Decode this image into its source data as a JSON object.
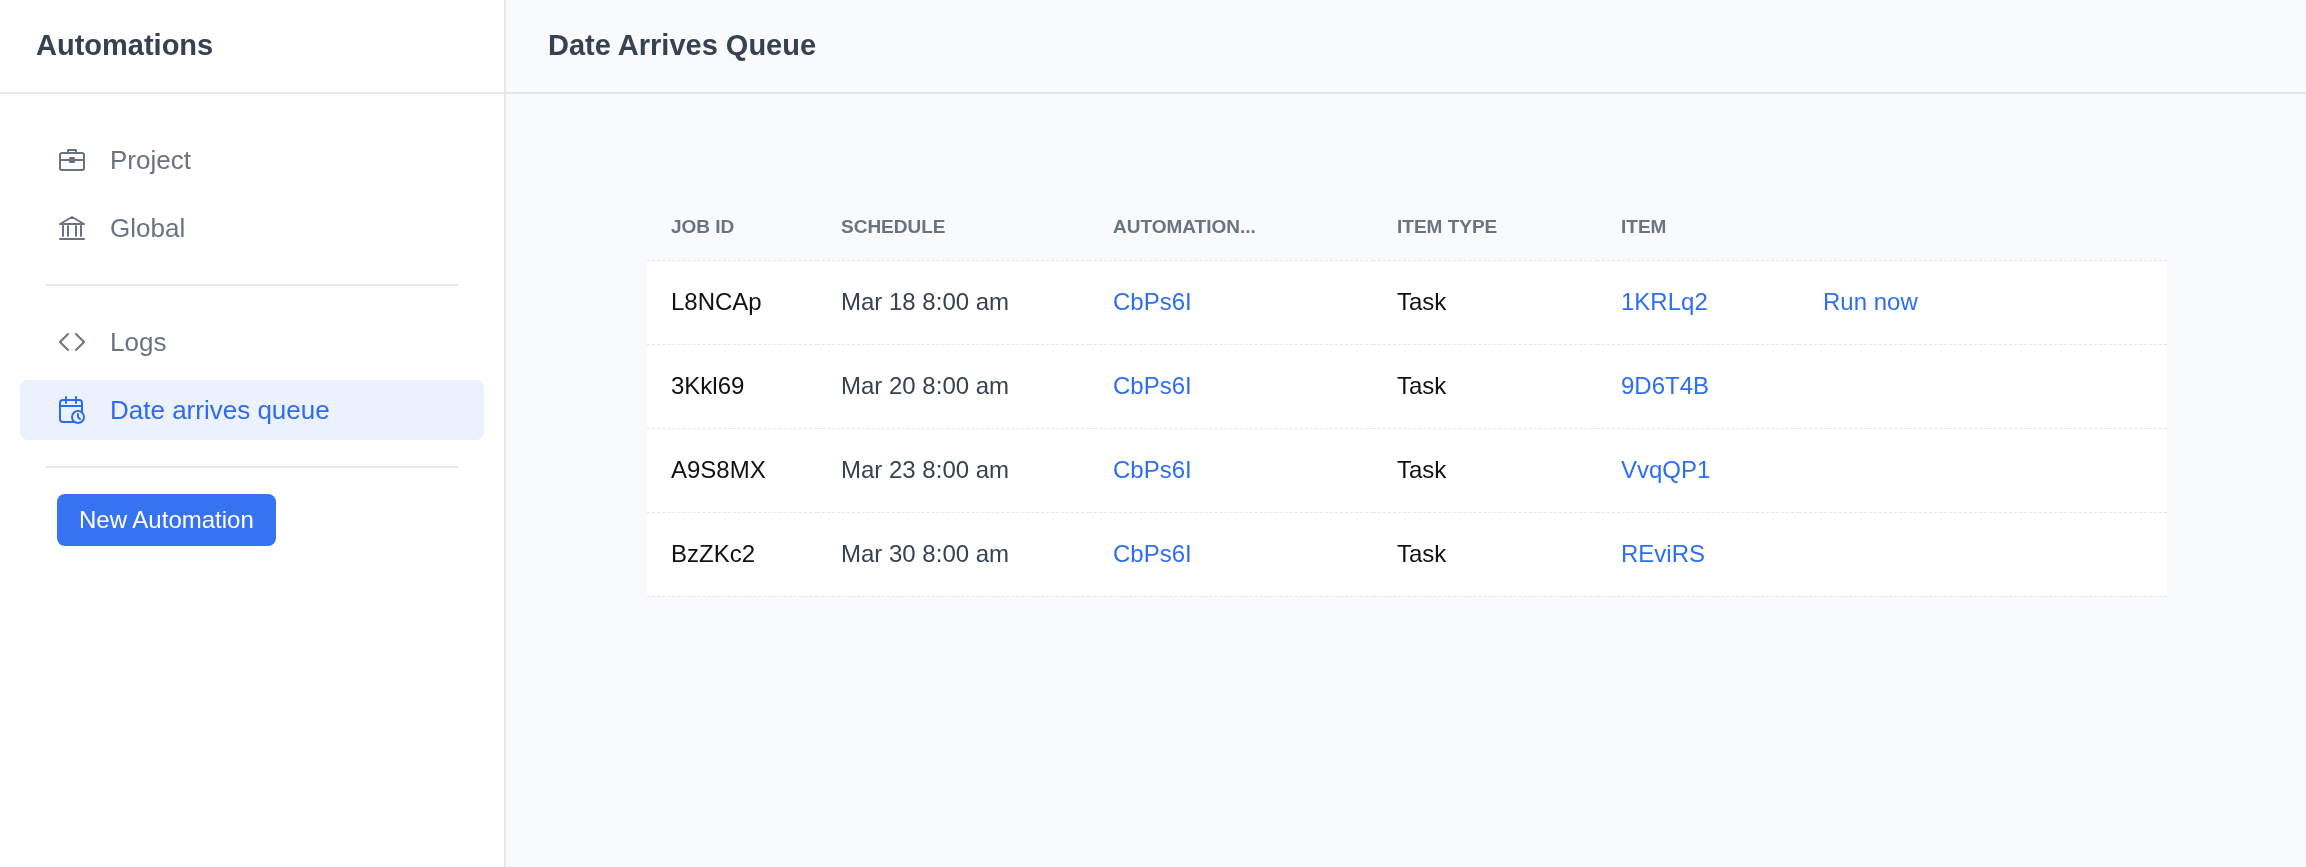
{
  "sidebar": {
    "title": "Automations",
    "groups": [
      [
        {
          "label": "Project",
          "selected": false
        },
        {
          "label": "Global",
          "selected": false
        }
      ],
      [
        {
          "label": "Logs",
          "selected": false
        },
        {
          "label": "Date arrives queue",
          "selected": true
        }
      ]
    ],
    "button": "New Automation"
  },
  "page": {
    "title": "Date Arrives Queue"
  },
  "table": {
    "columns": [
      "JOB ID",
      "SCHEDULE",
      "AUTOMATION...",
      "ITEM TYPE",
      "ITEM"
    ],
    "rows": [
      {
        "job_id": "L8NCAp",
        "schedule": "Mar 18 8:00 am",
        "automation": "CbPs6I",
        "item_type": "Task",
        "item": "1KRLq2",
        "action": "Run now"
      },
      {
        "job_id": "3Kkl69",
        "schedule": "Mar 20 8:00 am",
        "automation": "CbPs6I",
        "item_type": "Task",
        "item": "9D6T4B"
      },
      {
        "job_id": "A9S8MX",
        "schedule": "Mar 23 8:00 am",
        "automation": "CbPs6I",
        "item_type": "Task",
        "item": "VvqQP1"
      },
      {
        "job_id": "BzZKc2",
        "schedule": "Mar 30 8:00 am",
        "automation": "CbPs6I",
        "item_type": "Task",
        "item": "REviRS"
      }
    ]
  }
}
